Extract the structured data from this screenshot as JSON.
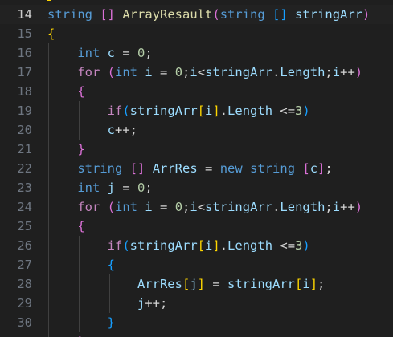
{
  "editor": {
    "lines": [
      {
        "number": "14",
        "current": true,
        "tokens": [
          {
            "text": "string",
            "kind": "kw"
          },
          {
            "text": " ",
            "kind": "op"
          },
          {
            "text": "[]",
            "kind": "br2"
          },
          {
            "text": " ",
            "kind": "op"
          },
          {
            "text": "ArrayResault",
            "kind": "fn"
          },
          {
            "text": "(",
            "kind": "br2"
          },
          {
            "text": "string",
            "kind": "kw"
          },
          {
            "text": " ",
            "kind": "op"
          },
          {
            "text": "[]",
            "kind": "br3"
          },
          {
            "text": " ",
            "kind": "op"
          },
          {
            "text": "stringArr",
            "kind": "var"
          },
          {
            "text": ")",
            "kind": "br2"
          }
        ]
      },
      {
        "number": "15",
        "tokens": [
          {
            "text": "{",
            "kind": "br1"
          }
        ]
      },
      {
        "number": "16",
        "tokens": [
          {
            "text": "    ",
            "kind": "op"
          },
          {
            "text": "int",
            "kind": "kw"
          },
          {
            "text": " ",
            "kind": "op"
          },
          {
            "text": "c",
            "kind": "var"
          },
          {
            "text": " = ",
            "kind": "op"
          },
          {
            "text": "0",
            "kind": "num"
          },
          {
            "text": ";",
            "kind": "op"
          }
        ]
      },
      {
        "number": "17",
        "tokens": [
          {
            "text": "    ",
            "kind": "op"
          },
          {
            "text": "for",
            "kind": "ctl"
          },
          {
            "text": " ",
            "kind": "op"
          },
          {
            "text": "(",
            "kind": "br2"
          },
          {
            "text": "int",
            "kind": "kw"
          },
          {
            "text": " ",
            "kind": "op"
          },
          {
            "text": "i",
            "kind": "var"
          },
          {
            "text": " = ",
            "kind": "op"
          },
          {
            "text": "0",
            "kind": "num"
          },
          {
            "text": ";",
            "kind": "op"
          },
          {
            "text": "i",
            "kind": "var"
          },
          {
            "text": "<",
            "kind": "op"
          },
          {
            "text": "stringArr",
            "kind": "var"
          },
          {
            "text": ".",
            "kind": "op"
          },
          {
            "text": "Length",
            "kind": "var"
          },
          {
            "text": ";",
            "kind": "op"
          },
          {
            "text": "i",
            "kind": "var"
          },
          {
            "text": "++",
            "kind": "op"
          },
          {
            "text": ")",
            "kind": "br2"
          }
        ]
      },
      {
        "number": "18",
        "tokens": [
          {
            "text": "    ",
            "kind": "op"
          },
          {
            "text": "{",
            "kind": "br2"
          }
        ]
      },
      {
        "number": "19",
        "tokens": [
          {
            "text": "        ",
            "kind": "op"
          },
          {
            "text": "if",
            "kind": "ctl"
          },
          {
            "text": "(",
            "kind": "br3"
          },
          {
            "text": "stringArr",
            "kind": "var"
          },
          {
            "text": "[",
            "kind": "br1"
          },
          {
            "text": "i",
            "kind": "var"
          },
          {
            "text": "]",
            "kind": "br1"
          },
          {
            "text": ".",
            "kind": "op"
          },
          {
            "text": "Length",
            "kind": "var"
          },
          {
            "text": " <=",
            "kind": "op"
          },
          {
            "text": "3",
            "kind": "num"
          },
          {
            "text": ")",
            "kind": "br3"
          }
        ]
      },
      {
        "number": "20",
        "tokens": [
          {
            "text": "        ",
            "kind": "op"
          },
          {
            "text": "c",
            "kind": "var"
          },
          {
            "text": "++;",
            "kind": "op"
          }
        ]
      },
      {
        "number": "21",
        "tokens": [
          {
            "text": "    ",
            "kind": "op"
          },
          {
            "text": "}",
            "kind": "br2"
          }
        ]
      },
      {
        "number": "22",
        "tokens": [
          {
            "text": "    ",
            "kind": "op"
          },
          {
            "text": "string",
            "kind": "kw"
          },
          {
            "text": " ",
            "kind": "op"
          },
          {
            "text": "[]",
            "kind": "br2"
          },
          {
            "text": " ",
            "kind": "op"
          },
          {
            "text": "ArrRes",
            "kind": "var"
          },
          {
            "text": " = ",
            "kind": "op"
          },
          {
            "text": "new",
            "kind": "kw"
          },
          {
            "text": " ",
            "kind": "op"
          },
          {
            "text": "string",
            "kind": "kw"
          },
          {
            "text": " ",
            "kind": "op"
          },
          {
            "text": "[",
            "kind": "br2"
          },
          {
            "text": "c",
            "kind": "var"
          },
          {
            "text": "]",
            "kind": "br2"
          },
          {
            "text": ";",
            "kind": "op"
          }
        ]
      },
      {
        "number": "23",
        "tokens": [
          {
            "text": "    ",
            "kind": "op"
          },
          {
            "text": "int",
            "kind": "kw"
          },
          {
            "text": " ",
            "kind": "op"
          },
          {
            "text": "j",
            "kind": "var"
          },
          {
            "text": " = ",
            "kind": "op"
          },
          {
            "text": "0",
            "kind": "num"
          },
          {
            "text": ";",
            "kind": "op"
          }
        ]
      },
      {
        "number": "24",
        "tokens": [
          {
            "text": "    ",
            "kind": "op"
          },
          {
            "text": "for",
            "kind": "ctl"
          },
          {
            "text": " ",
            "kind": "op"
          },
          {
            "text": "(",
            "kind": "br2"
          },
          {
            "text": "int",
            "kind": "kw"
          },
          {
            "text": " ",
            "kind": "op"
          },
          {
            "text": "i",
            "kind": "var"
          },
          {
            "text": " = ",
            "kind": "op"
          },
          {
            "text": "0",
            "kind": "num"
          },
          {
            "text": ";",
            "kind": "op"
          },
          {
            "text": "i",
            "kind": "var"
          },
          {
            "text": "<",
            "kind": "op"
          },
          {
            "text": "stringArr",
            "kind": "var"
          },
          {
            "text": ".",
            "kind": "op"
          },
          {
            "text": "Length",
            "kind": "var"
          },
          {
            "text": ";",
            "kind": "op"
          },
          {
            "text": "i",
            "kind": "var"
          },
          {
            "text": "++",
            "kind": "op"
          },
          {
            "text": ")",
            "kind": "br2"
          }
        ]
      },
      {
        "number": "25",
        "tokens": [
          {
            "text": "    ",
            "kind": "op"
          },
          {
            "text": "{",
            "kind": "br2"
          }
        ]
      },
      {
        "number": "26",
        "tokens": [
          {
            "text": "        ",
            "kind": "op"
          },
          {
            "text": "if",
            "kind": "ctl"
          },
          {
            "text": "(",
            "kind": "br3"
          },
          {
            "text": "stringArr",
            "kind": "var"
          },
          {
            "text": "[",
            "kind": "br1"
          },
          {
            "text": "i",
            "kind": "var"
          },
          {
            "text": "]",
            "kind": "br1"
          },
          {
            "text": ".",
            "kind": "op"
          },
          {
            "text": "Length",
            "kind": "var"
          },
          {
            "text": " <=",
            "kind": "op"
          },
          {
            "text": "3",
            "kind": "num"
          },
          {
            "text": ")",
            "kind": "br3"
          }
        ]
      },
      {
        "number": "27",
        "tokens": [
          {
            "text": "        ",
            "kind": "op"
          },
          {
            "text": "{",
            "kind": "br3"
          }
        ]
      },
      {
        "number": "28",
        "tokens": [
          {
            "text": "            ",
            "kind": "op"
          },
          {
            "text": "ArrRes",
            "kind": "var"
          },
          {
            "text": "[",
            "kind": "br1"
          },
          {
            "text": "j",
            "kind": "var"
          },
          {
            "text": "]",
            "kind": "br1"
          },
          {
            "text": " = ",
            "kind": "op"
          },
          {
            "text": "stringArr",
            "kind": "var"
          },
          {
            "text": "[",
            "kind": "br1"
          },
          {
            "text": "i",
            "kind": "var"
          },
          {
            "text": "]",
            "kind": "br1"
          },
          {
            "text": ";",
            "kind": "op"
          }
        ]
      },
      {
        "number": "29",
        "tokens": [
          {
            "text": "            ",
            "kind": "op"
          },
          {
            "text": "j",
            "kind": "var"
          },
          {
            "text": "++;",
            "kind": "op"
          }
        ]
      },
      {
        "number": "30",
        "tokens": [
          {
            "text": "        ",
            "kind": "op"
          },
          {
            "text": "}",
            "kind": "br3"
          }
        ]
      },
      {
        "number": "",
        "tokens": [
          {
            "text": "    ",
            "kind": "op"
          },
          {
            "text": "}",
            "kind": "br2"
          }
        ]
      }
    ]
  }
}
